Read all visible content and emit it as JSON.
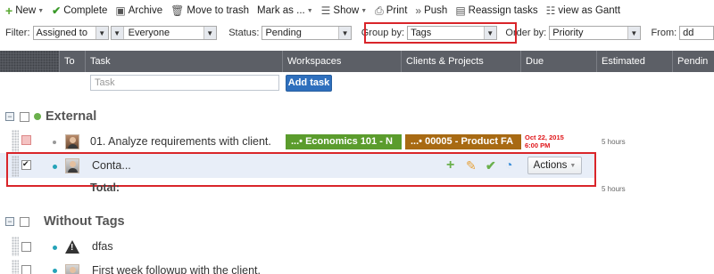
{
  "toolbar": {
    "new": "New",
    "complete": "Complete",
    "archive": "Archive",
    "move_to_trash": "Move to trash",
    "mark_as": "Mark as ...",
    "show": "Show",
    "print": "Print",
    "push": "Push",
    "reassign": "Reassign tasks",
    "gantt": "view as Gantt"
  },
  "filters": {
    "filter_label": "Filter:",
    "filter_value": "Assigned to",
    "assignee_value": "Everyone",
    "status_label": "Status:",
    "status_value": "Pending",
    "groupby_label": "Group by:",
    "groupby_value": "Tags",
    "orderby_label": "Order by:",
    "orderby_value": "Priority",
    "from_label": "From:",
    "from_value": "dd"
  },
  "columns": {
    "to": "To",
    "task": "Task",
    "workspaces": "Workspaces",
    "clients_projects": "Clients & Projects",
    "due": "Due",
    "estimated": "Estimated",
    "pending": "Pendin"
  },
  "new_task": {
    "placeholder": "Task",
    "add_button": "Add task"
  },
  "groups": [
    {
      "title": "External",
      "tasks": [
        {
          "name": "01. Analyze requirements with client.",
          "workspace_tag": "...• Economics 101 - N",
          "project_tag": "...• 00005 - Product FA",
          "due_date": "Oct 22, 2015",
          "due_time": "6:00 PM",
          "estimated": "5 hours"
        },
        {
          "name": "Conta...",
          "actions_label": "Actions"
        }
      ],
      "total_label": "Total:",
      "total_estimated": "5 hours"
    },
    {
      "title": "Without Tags",
      "tasks": [
        {
          "name": "dfas"
        },
        {
          "name": "First week followup with the client."
        }
      ]
    }
  ],
  "colors": {
    "header_bg": "#5c5f66",
    "highlight_border": "#d9252a",
    "add_button": "#2e6fbd",
    "workspace_tag": "#5b9c2d",
    "project_tag": "#a86a13",
    "due_red": "#e0161a"
  }
}
